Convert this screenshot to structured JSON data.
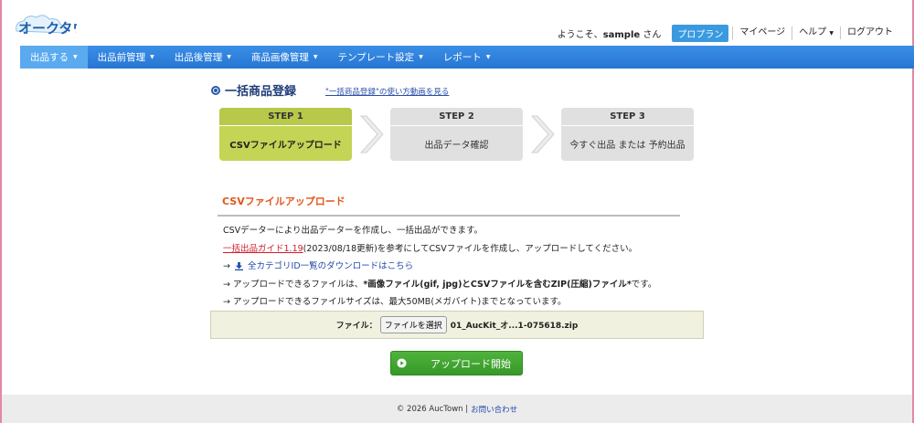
{
  "header": {
    "logo_text": "オークタウン",
    "welcome_prefix": "ようこそ、",
    "username": "sample",
    "welcome_suffix": " さん",
    "plan": "プロプラン",
    "links": [
      "マイページ",
      "ヘルプ",
      "ログアウト"
    ]
  },
  "nav": {
    "items": [
      "出品する",
      "出品前管理",
      "出品後管理",
      "商品画像管理",
      "テンプレート設定",
      "レポート"
    ]
  },
  "page": {
    "title": "一括商品登録",
    "video_link": "\"一括商品登録\"の使い方動画を見る"
  },
  "steps": [
    {
      "label": "STEP 1",
      "text": "CSVファイルアップロード"
    },
    {
      "label": "STEP 2",
      "text": "出品データ確認"
    },
    {
      "label": "STEP 3",
      "text": "今すぐ出品 または 予約出品"
    }
  ],
  "section": {
    "title": "CSVファイルアップロード",
    "line1": "CSVデーターにより出品データーを作成し、一括出品ができます。",
    "guide_link": "一括出品ガイド1.19",
    "line2_rest": "(2023/08/18更新)を参考にしてCSVファイルを作成し、アップロードしてください。",
    "arrow": "→",
    "line3_link": "全カテゴリID一覧のダウンロードはこちら",
    "line4_pre": "アップロードできるファイルは、",
    "line4_bold": "*画像ファイル(gif, jpg)とCSVファイルを含むZIP(圧縮)ファイル*",
    "line4_post": "です。",
    "line5": "アップロードできるファイルサイズは、最大50MB(メガバイト)までとなっています。"
  },
  "file": {
    "label": "ファイル：",
    "button": "ファイルを選択",
    "filename": "01_AucKit_オ...1-075618.zip"
  },
  "upload": {
    "label": "アップロード開始"
  },
  "footer": {
    "copyright": "© 2026 AucTown |",
    "contact": "お問い合わせ"
  },
  "colors": {
    "nav": "#2776d4",
    "active_step": "#c4d455",
    "accent_orange": "#e0561a",
    "upload_green": "#379a28"
  }
}
